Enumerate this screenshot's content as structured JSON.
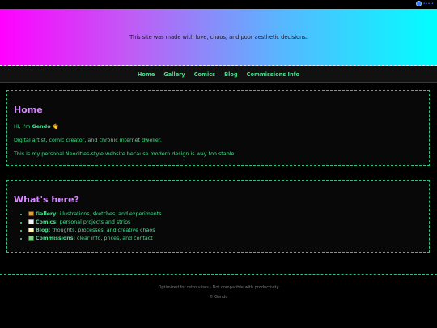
{
  "topbar": {
    "indicator_text": "••• •"
  },
  "banner": {
    "tagline": "This site was made with love, chaos, and poor aesthetic decisions."
  },
  "nav": {
    "items": [
      "Home",
      "Gallery",
      "Comics",
      "Blog",
      "Commissions Info"
    ]
  },
  "home": {
    "title": "Home",
    "greeting_prefix": "Hi, I'm ",
    "name": "Gendo",
    "greeting_emoji": "👋",
    "line2": "Digital artist, comic creator, and chronic internet dweller.",
    "line3": "This is my personal Neocities-style website because modern design is way too stable."
  },
  "whats_here": {
    "title": "What's here?",
    "items": [
      {
        "icon": "framed-picture-icon",
        "label": "Gallery:",
        "desc": " illustrations, sketches, and experiments"
      },
      {
        "icon": "book-icon",
        "label": "Comics:",
        "desc": " personal projects and strips"
      },
      {
        "icon": "memo-icon",
        "label": "Blog:",
        "desc": " thoughts, processes, and creative chaos"
      },
      {
        "icon": "money-icon",
        "label": "Commissions:",
        "desc": " clear info, prices, and contact"
      }
    ]
  },
  "footer": {
    "line1": "Optimized for retro vibes · Not compatible with productivity",
    "line2": "© Gendo"
  },
  "colors": {
    "accent": "#3fe08a",
    "heading": "#d58cff",
    "background": "#000000"
  }
}
